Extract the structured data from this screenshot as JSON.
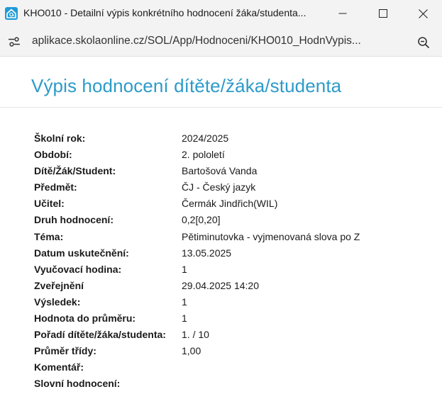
{
  "window": {
    "title": "KHO010 - Detailní výpis konkrétního hodnocení žáka/studenta..."
  },
  "address": {
    "url": "aplikace.skolaonline.cz/SOL/App/Hodnoceni/KHO010_HodnVypis..."
  },
  "page": {
    "title": "Výpis hodnocení dítěte/žáka/studenta"
  },
  "details": [
    {
      "label": "Školní rok:",
      "value": "2024/2025"
    },
    {
      "label": "Období:",
      "value": "2. pololetí"
    },
    {
      "label": "Dítě/Žák/Student:",
      "value": "Bartošová Vanda"
    },
    {
      "label": "Předmět:",
      "value": "ČJ - Český jazyk"
    },
    {
      "label": "Učitel:",
      "value": "Čermák Jindřich(WIL)"
    },
    {
      "label": "Druh hodnocení:",
      "value": "0,2[0,20]"
    },
    {
      "label": "Téma:",
      "value": "Pětiminutovka - vyjmenovaná slova po Z"
    },
    {
      "label": "Datum uskutečnění:",
      "value": "13.05.2025"
    },
    {
      "label": "Vyučovací hodina:",
      "value": "1"
    },
    {
      "label": "Zveřejnění",
      "value": "29.04.2025 14:20"
    },
    {
      "label": "Výsledek:",
      "value": "1"
    },
    {
      "label": "Hodnota do průměru:",
      "value": "1"
    },
    {
      "label": "Pořadí dítěte/žáka/studenta:",
      "value": "1. / 10"
    },
    {
      "label": "Průměr třídy:",
      "value": "1,00"
    },
    {
      "label": "Komentář:",
      "value": ""
    },
    {
      "label": "Slovní hodnocení:",
      "value": ""
    }
  ],
  "colors": {
    "title_accent": "#2d9bc9",
    "chrome_bg": "#f3f3f3"
  },
  "icons": {
    "app": "home-at-icon",
    "minimize": "minimize-icon",
    "maximize": "maximize-icon",
    "close": "close-icon",
    "site_info": "site-settings-icon",
    "zoom": "zoom-out-icon"
  }
}
